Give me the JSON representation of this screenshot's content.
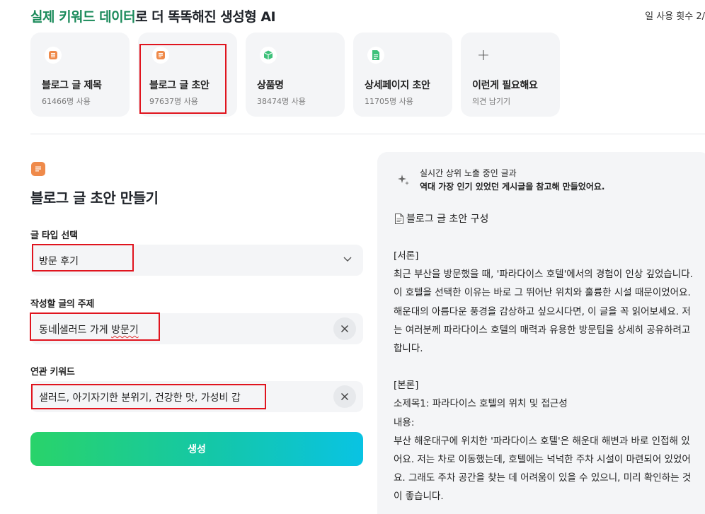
{
  "header": {
    "title_highlight": "실제 키워드 데이터",
    "title_rest": "로 더 똑똑해진 생성형 AI",
    "usage_text": "일 사용 횟수 2/"
  },
  "cards": [
    {
      "name": "블로그 글 제목",
      "sub": "61466명 사용",
      "icon": "list-icon",
      "color": "#ef8a4a"
    },
    {
      "name": "블로그 글 초안",
      "sub": "97637명 사용",
      "icon": "document-icon",
      "color": "#ef8a4a"
    },
    {
      "name": "상품명",
      "sub": "38474명 사용",
      "icon": "box-icon",
      "color": "#3ec17a"
    },
    {
      "name": "상세페이지 초안",
      "sub": "11705명 사용",
      "icon": "page-icon",
      "color": "#3ec17a"
    },
    {
      "name": "이런게 필요해요",
      "sub": "의견 남기기",
      "icon": "plus-icon",
      "color": "#555555"
    }
  ],
  "form": {
    "title": "블로그 글 초안 만들기",
    "type_label": "글 타입 선택",
    "type_value": "방문 후기",
    "topic_label": "작성할 글의 주제",
    "topic_value_a": "동네",
    "topic_value_b": "샐러드 가게 ",
    "topic_value_c": "방문기",
    "keyword_label": "연관 키워드",
    "keyword_value": "샐러드, 아기자기한 분위기, 건강한 맛, 가성비 갑",
    "generate_label": "생성"
  },
  "panel": {
    "hint_line1": "실시간 상위 노출 중인 글과",
    "hint_line2": "역대 가장 인기 있었던 게시글을 참고해 만들었어요.",
    "doc_heading": "블로그 글 초안 구성",
    "intro_tag": "[서론]",
    "intro_text": "최근 부산을 방문했을 때, '파라다이스 호텔'에서의 경험이 인상 깊었습니다. 이 호텔을 선택한 이유는 바로 그 뛰어난 위치와 훌륭한 시설 때문이었어요. 해운대의 아름다운 풍경을 감상하고 싶으시다면, 이 글을 꼭 읽어보세요. 저는 여러분께 파라다이스 호텔의 매력과 유용한 방문팁을 상세히 공유하려고 합니다.",
    "body_tag": "[본론]",
    "subtitle1": "소제목1: 파라다이스 호텔의 위치 및 접근성",
    "content_label": "내용:",
    "content_text": "부산 해운대구에 위치한 '파라다이스 호텔'은 해운대 해변과 바로 인접해 있어요. 저는 차로 이동했는데, 호텔에는 넉넉한 주차 시설이 마련되어 있었어요. 그래도 주차 공간을 찾는 데 어려움이 있을 수 있으니, 미리 확인하는 것이 좋습니다."
  },
  "colors": {
    "highlight_green": "#1a8a5a",
    "orange_icon": "#ef8a4a",
    "green_icon": "#3ec17a",
    "annotation_red": "#e0141e",
    "gradient_start": "#29d36a",
    "gradient_end": "#09c3e3"
  }
}
